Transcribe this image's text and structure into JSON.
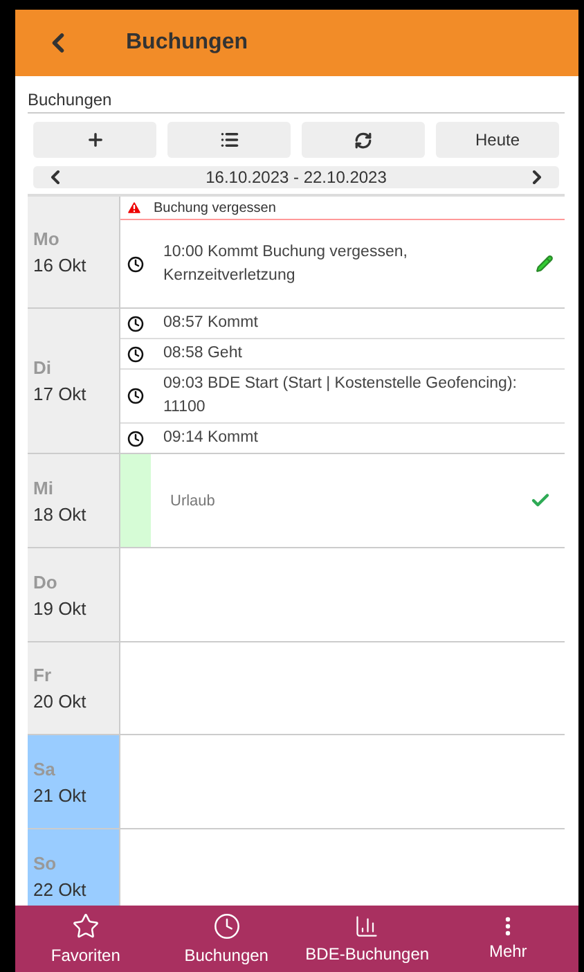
{
  "header": {
    "title": "Buchungen"
  },
  "section_title": "Buchungen",
  "toolbar": [
    {
      "kind": "add"
    },
    {
      "kind": "list"
    },
    {
      "kind": "refresh"
    },
    {
      "kind": "text",
      "label": "Heute"
    }
  ],
  "date_range": "16.10.2023 - 22.10.2023",
  "days": [
    {
      "weekday": "Mo",
      "date": "16 Okt",
      "weekend": false,
      "warning": "Buchung vergessen",
      "entries": [
        {
          "kind": "booking",
          "text": "10:00 Kommt Buchung vergessen, Kernzeitverletzung",
          "editable": true
        }
      ]
    },
    {
      "weekday": "Di",
      "date": "17 Okt",
      "weekend": false,
      "entries": [
        {
          "kind": "booking",
          "text": "08:57 Kommt",
          "editable": false
        },
        {
          "kind": "booking",
          "text": "08:58 Geht",
          "editable": false
        },
        {
          "kind": "booking",
          "text": "09:03 BDE Start (Start | Kostenstelle Geofencing): 11100",
          "editable": false
        },
        {
          "kind": "booking",
          "text": "09:14 Kommt",
          "editable": false
        }
      ]
    },
    {
      "weekday": "Mi",
      "date": "18 Okt",
      "weekend": false,
      "entries": [
        {
          "kind": "absence",
          "text": "Urlaub",
          "approved": true
        }
      ]
    },
    {
      "weekday": "Do",
      "date": "19 Okt",
      "weekend": false
    },
    {
      "weekday": "Fr",
      "date": "20 Okt",
      "weekend": false
    },
    {
      "weekday": "Sa",
      "date": "21 Okt",
      "weekend": true
    },
    {
      "weekday": "So",
      "date": "22 Okt",
      "weekend": true
    }
  ],
  "bottom_nav": [
    {
      "kind": "star",
      "label": "Favoriten"
    },
    {
      "kind": "clock",
      "label": "Buchungen"
    },
    {
      "kind": "chart",
      "label": "BDE-Buchungen"
    },
    {
      "kind": "more",
      "label": "Mehr"
    }
  ]
}
